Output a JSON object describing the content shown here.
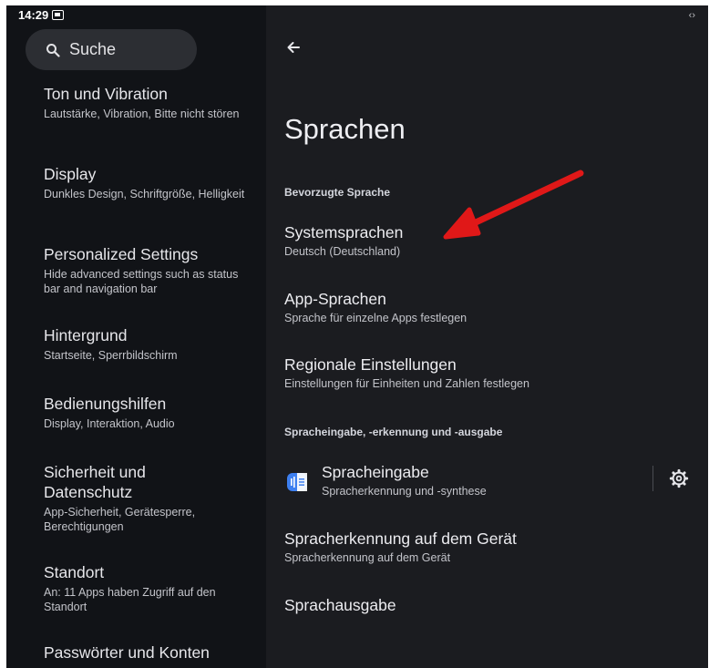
{
  "status": {
    "time": "14:29"
  },
  "sidebar": {
    "search_placeholder": "Suche",
    "items": [
      {
        "title": "Ton und Vibration",
        "subtitle": "Lautstärke, Vibration, Bitte nicht stören"
      },
      {
        "title": "Display",
        "subtitle": "Dunkles Design, Schriftgröße, Helligkeit"
      },
      {
        "title": "Personalized Settings",
        "subtitle": "Hide advanced settings such as status bar and navigation bar"
      },
      {
        "title": "Hintergrund",
        "subtitle": "Startseite, Sperrbildschirm"
      },
      {
        "title": "Bedienungshilfen",
        "subtitle": "Display, Interaktion, Audio"
      },
      {
        "title": "Sicherheit und Datenschutz",
        "subtitle": "App-Sicherheit, Gerätesperre, Berechtigungen"
      },
      {
        "title": "Standort",
        "subtitle": "An: 11 Apps haben Zugriff auf den Standort"
      },
      {
        "title": "Passwörter und Konten",
        "subtitle": ""
      }
    ]
  },
  "main": {
    "title": "Sprachen",
    "sections": [
      {
        "header": "Bevorzugte Sprache",
        "items": [
          {
            "title": "Systemsprachen",
            "subtitle": "Deutsch (Deutschland)"
          },
          {
            "title": "App-Sprachen",
            "subtitle": "Sprache für einzelne Apps festlegen"
          },
          {
            "title": "Regionale Einstellungen",
            "subtitle": "Einstellungen für Einheiten und Zahlen festlegen"
          }
        ]
      },
      {
        "header": "Spracheingabe, -erkennung und -ausgabe",
        "items": [
          {
            "title": "Spracheingabe",
            "subtitle": "Spracherkennung und -synthese"
          },
          {
            "title": "Spracherkennung auf dem Gerät",
            "subtitle": "Spracherkennung auf dem Gerät"
          },
          {
            "title": "Sprachausgabe",
            "subtitle": ""
          }
        ]
      }
    ]
  },
  "icons": {
    "back": "arrow-back-icon",
    "search": "search-icon",
    "settings": "gear-icon",
    "voice_input": "voice-input-icon",
    "annotation": "red-arrow-annotation"
  },
  "colors": {
    "accent_blue": "#3d7ff0",
    "annotation_red": "#e01818"
  }
}
